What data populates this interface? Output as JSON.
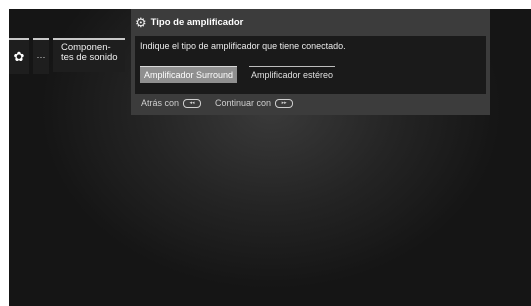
{
  "nav": {
    "settings_icon": "gear-icon",
    "more": "···",
    "current_item": "Componen-\ntes de sonido"
  },
  "dialog": {
    "title": "Tipo de amplificador",
    "title_icon": "gears-icon",
    "prompt": "Indique el tipo de amplificador que tiene conectado.",
    "options": [
      {
        "label": "Amplificador Surround",
        "selected": true
      },
      {
        "label": "Amplificador estéreo",
        "selected": false
      }
    ]
  },
  "footer": {
    "back_label": "Atrás con",
    "continue_label": "Continuar con"
  },
  "colors": {
    "panel": "#3c3c3c",
    "panel_body": "#1a1a1a",
    "selected": "#8f8f8f"
  }
}
